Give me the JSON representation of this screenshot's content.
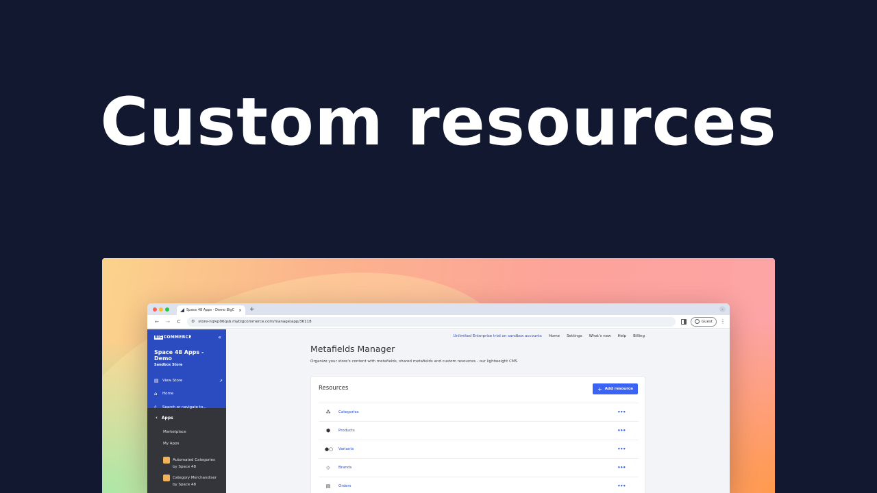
{
  "hero": {
    "title": "Custom resources"
  },
  "browser": {
    "tab_title": "Space 48 Apps - Demo BigC",
    "tab_close": "×",
    "new_tab": "+",
    "tab_menu": "⌄",
    "url": "store-nqlvp06qsb.mybigcommerce.com/manage/app/36118",
    "guest_label": "Guest",
    "back": "←",
    "forward": "→",
    "reload": "C",
    "kebab": "⋮"
  },
  "sidebar": {
    "logo_big": "BIG",
    "logo_rest": "COMMERCE",
    "collapse": "«",
    "store_name": "Space 48 Apps - Demo",
    "store_sub": "Sandbox Store",
    "items": [
      {
        "label": "View Store",
        "icon": "storefront-icon"
      },
      {
        "label": "Home",
        "icon": "home-icon"
      },
      {
        "label": "Search or navigate to...",
        "icon": "search-icon"
      }
    ],
    "section": {
      "label": "Apps",
      "chevron": "‹"
    },
    "sub_items": [
      "Marketplace",
      "My Apps"
    ],
    "apps": [
      {
        "line1": "Automated Categories",
        "line2": "by Space 48"
      },
      {
        "line1": "Category Merchandiser",
        "line2": "by Space 48"
      }
    ]
  },
  "topnav": {
    "trial": "Unlimited Enterprise trial on sandbox accounts",
    "links": [
      "Home",
      "Settings",
      "What's new",
      "Help",
      "Billing"
    ]
  },
  "page": {
    "title": "Metafields Manager",
    "description": "Organize your store's content with metafields, shared metafields and custom resources - our lightweight CMS"
  },
  "resources": {
    "title": "Resources",
    "add_button": "Add resource",
    "add_plus": "+",
    "rows": [
      {
        "label": "Categories",
        "icon": "categories-icon",
        "glyph": "⁂",
        "more": "•••"
      },
      {
        "label": "Products",
        "icon": "box-icon",
        "glyph": "⬢",
        "more": "•••"
      },
      {
        "label": "Variants",
        "icon": "variants-icon",
        "glyph": "●○",
        "more": "•••"
      },
      {
        "label": "Brands",
        "icon": "tag-icon",
        "glyph": "◇",
        "more": "•••"
      },
      {
        "label": "Orders",
        "icon": "orders-icon",
        "glyph": "▤",
        "more": "•••"
      }
    ]
  },
  "colors": {
    "background": "#121830",
    "sidebar_blue": "#2b4bc0",
    "accent": "#3c64f4"
  }
}
